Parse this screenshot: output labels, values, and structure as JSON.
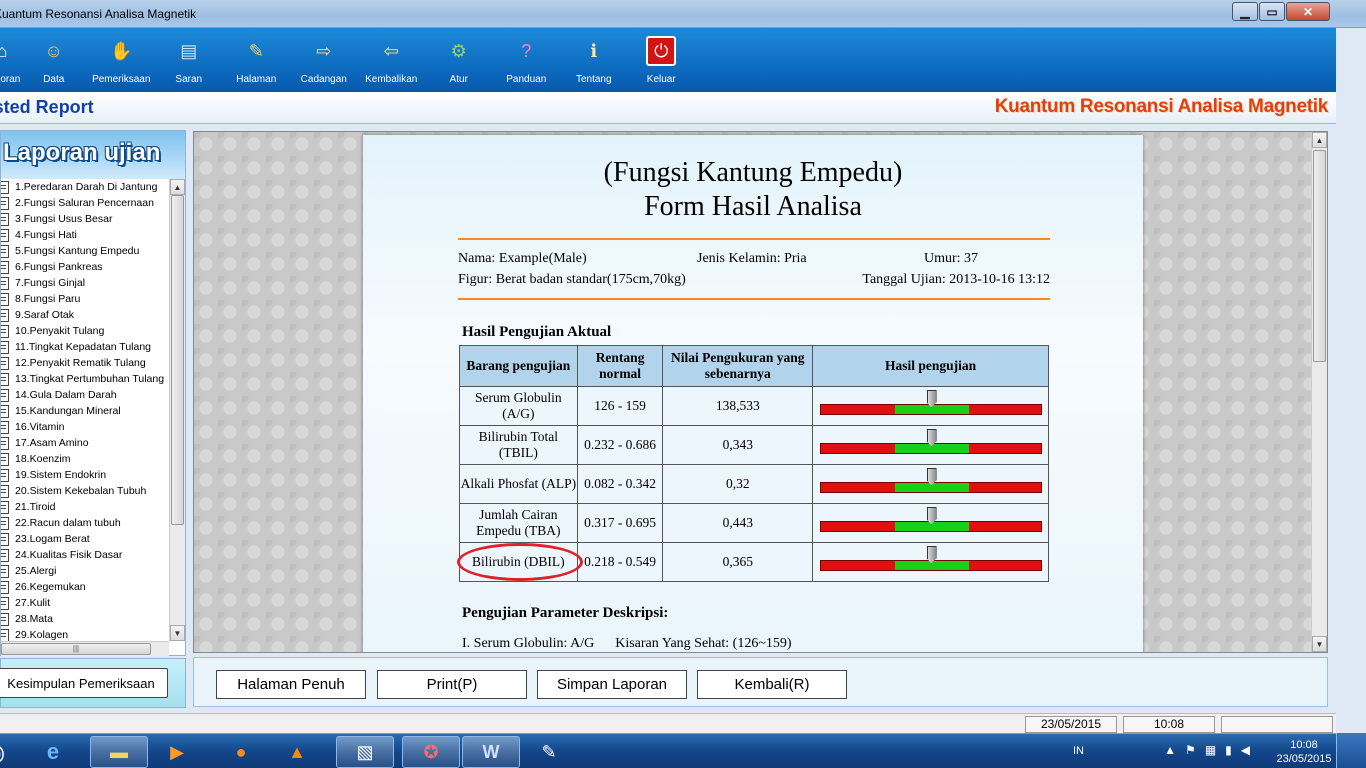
{
  "window": {
    "title": "Kuantum Resonansi Analisa Magnetik"
  },
  "toolbar": {
    "items": [
      {
        "label": "Laporan",
        "icon": "home-icon",
        "glyph": "⌂"
      },
      {
        "label": "Data",
        "icon": "users-icon",
        "glyph": "☺"
      },
      {
        "label": "Pemeriksaan",
        "icon": "hand-icon",
        "glyph": "✋"
      },
      {
        "label": "Saran",
        "icon": "document-chart-icon",
        "glyph": "▤"
      },
      {
        "label": "Halaman",
        "icon": "page-edit-icon",
        "glyph": "✎"
      },
      {
        "label": "Cadangan",
        "icon": "backup-icon",
        "glyph": "⇨"
      },
      {
        "label": "Kembalikan",
        "icon": "restore-icon",
        "glyph": "⇦"
      },
      {
        "label": "Atur",
        "icon": "gears-icon",
        "glyph": "⚙"
      },
      {
        "label": "Panduan",
        "icon": "help-book-icon",
        "glyph": "?"
      },
      {
        "label": "Tentang",
        "icon": "about-icon",
        "glyph": "ℹ"
      },
      {
        "label": "Keluar",
        "icon": "power-icon",
        "glyph": "⏻"
      }
    ]
  },
  "header": {
    "left_title": "Tested Report",
    "right_title": "Kuantum Resonansi Analisa Magnetik"
  },
  "left_panel": {
    "title": "Laporan ujian",
    "items": [
      "1.Peredaran Darah Di Jantung",
      "2.Fungsi Saluran Pencernaan",
      "3.Fungsi Usus Besar",
      "4.Fungsi Hati",
      "5.Fungsi Kantung Empedu",
      "6.Fungsi Pankreas",
      "7.Fungsi Ginjal",
      "8.Fungsi Paru",
      "9.Saraf Otak",
      "10.Penyakit Tulang",
      "11.Tingkat Kepadatan Tulang",
      "12.Penyakit Rematik Tulang",
      "13.Tingkat Pertumbuhan Tulang",
      "14.Gula Dalam Darah",
      "15.Kandungan Mineral",
      "16.Vitamin",
      "17.Asam Amino",
      "18.Koenzim",
      "19.Sistem Endokrin",
      "20.Sistem Kekebalan Tubuh",
      "21.Tiroid",
      "22.Racun dalam tubuh",
      "23.Logam Berat",
      "24.Kualitas Fisik Dasar",
      "25.Alergi",
      "26.Kegemukan",
      "27.Kulit",
      "28.Mata",
      "29.Kolagen"
    ],
    "summary_button": "Kesimpulan Pemeriksaan"
  },
  "report": {
    "title1": "(Fungsi Kantung Empedu)",
    "title2": "Form Hasil Analisa",
    "name": "Nama: Example(Male)",
    "gender": "Jenis Kelamin: Pria",
    "age": "Umur: 37",
    "figure": "Figur: Berat badan standar(175cm,70kg)",
    "test_date": "Tanggal Ujian: 2013-10-16 13:12",
    "section_actual": "Hasil Pengujian Aktual",
    "columns": [
      "Barang pengujian",
      "Rentang normal",
      "Nilai Pengukuran yang sebenarnya",
      "Hasil pengujian"
    ],
    "rows": [
      {
        "item": "Serum Globulin (A/G)",
        "range": "126 - 159",
        "value": "138,533",
        "level": 0.5
      },
      {
        "item": "Bilirubin Total (TBIL)",
        "range": "0.232 - 0.686",
        "value": "0,343",
        "level": 0.5
      },
      {
        "item": "Alkali Phosfat (ALP)",
        "range": "0.082 - 0.342",
        "value": "0,32",
        "level": 0.5
      },
      {
        "item": "Jumlah Cairan Empedu (TBA)",
        "range": "0.317 - 0.695",
        "value": "0,443",
        "level": 0.5
      },
      {
        "item": "Bilirubin (DBIL)",
        "range": "0.218 - 0.549",
        "value": "0,365",
        "level": 0.5
      }
    ],
    "section_desc": "Pengujian Parameter Deskripsi:",
    "desc_line": "I. Serum Globulin: A/G      Kisaran Yang Sehat: (126~159)"
  },
  "buttons": {
    "full_page": "Halaman Penuh",
    "print": "Print(P)",
    "save": "Simpan Laporan",
    "back": "Kembali(R)"
  },
  "status": {
    "date": "23/05/2015",
    "time": "10:08"
  },
  "taskbar": {
    "lang": "IN",
    "clock_time": "10:08",
    "clock_date": "23/05/2015"
  },
  "colors": {
    "accent_orange": "#e0400a",
    "toolbar_blue": "#0a63b8",
    "bar_red": "#e01010",
    "bar_green": "#18d018"
  }
}
